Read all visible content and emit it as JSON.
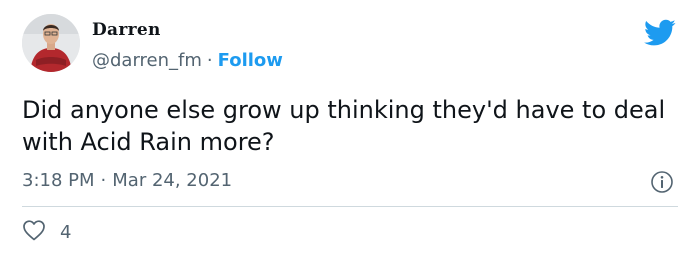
{
  "tweet": {
    "display_name": "Darren",
    "handle": "@darren_fm",
    "separator": "·",
    "follow_label": "Follow",
    "text": "Did anyone else grow up thinking they'd have to deal with Acid Rain more?",
    "time": "3:18 PM",
    "date": "Mar 24, 2021",
    "like_count": "4"
  },
  "icons": {
    "brand": "twitter-bird-icon",
    "info": "info-icon",
    "like": "heart-icon"
  },
  "colors": {
    "accent": "#1d9bf0",
    "text": "#0f1419",
    "secondary_text": "#536471",
    "divider": "#cfd9de"
  }
}
